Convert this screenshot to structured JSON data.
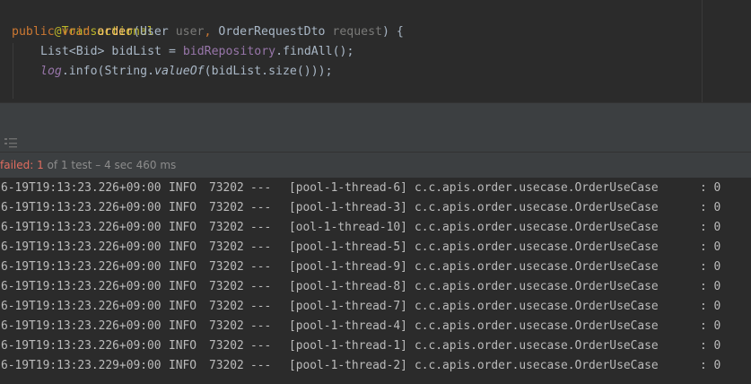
{
  "editor": {
    "line1": {
      "annotation": "@Transactional"
    },
    "line2": {
      "kw_public": "public",
      "kw_void": "void",
      "method": "order",
      "open": "(",
      "type_user": "User",
      "param_user": "user",
      "comma": ",",
      "type_dto": "OrderRequestDto",
      "param_request": "request",
      "close": ") {"
    },
    "line3": {
      "type": "List<Bid>",
      "var": "bidList",
      "eq": "=",
      "field": "bidRepository",
      "call": ".findAll();"
    },
    "line4": {
      "field": "log",
      "call1": ".info(String.",
      "static_method": "valueOf",
      "call2": "(bidList.size()));"
    }
  },
  "status": {
    "failed_label": "failed:",
    "failed_count": "1",
    "summary": "of 1 test – 4 sec 460 ms"
  },
  "colors": {
    "failed": "#e06c5f",
    "annotation": "#bbb529",
    "keyword": "#cc7832",
    "method": "#ffc66d",
    "field": "#9876aa"
  },
  "console": {
    "lines": [
      {
        "ts": "6-19T19:13:23.226+09:00",
        "level": "INFO",
        "pid": "73202",
        "sep": "---",
        "thread": "[pool-1-thread-6]",
        "logger": "c.c.apis.order.usecase.OrderUseCase",
        "msg": ": 0"
      },
      {
        "ts": "6-19T19:13:23.226+09:00",
        "level": "INFO",
        "pid": "73202",
        "sep": "---",
        "thread": "[pool-1-thread-3]",
        "logger": "c.c.apis.order.usecase.OrderUseCase",
        "msg": ": 0"
      },
      {
        "ts": "6-19T19:13:23.226+09:00",
        "level": "INFO",
        "pid": "73202",
        "sep": "---",
        "thread": "[ool-1-thread-10]",
        "logger": "c.c.apis.order.usecase.OrderUseCase",
        "msg": ": 0"
      },
      {
        "ts": "6-19T19:13:23.226+09:00",
        "level": "INFO",
        "pid": "73202",
        "sep": "---",
        "thread": "[pool-1-thread-5]",
        "logger": "c.c.apis.order.usecase.OrderUseCase",
        "msg": ": 0"
      },
      {
        "ts": "6-19T19:13:23.226+09:00",
        "level": "INFO",
        "pid": "73202",
        "sep": "---",
        "thread": "[pool-1-thread-9]",
        "logger": "c.c.apis.order.usecase.OrderUseCase",
        "msg": ": 0"
      },
      {
        "ts": "6-19T19:13:23.226+09:00",
        "level": "INFO",
        "pid": "73202",
        "sep": "---",
        "thread": "[pool-1-thread-8]",
        "logger": "c.c.apis.order.usecase.OrderUseCase",
        "msg": ": 0"
      },
      {
        "ts": "6-19T19:13:23.226+09:00",
        "level": "INFO",
        "pid": "73202",
        "sep": "---",
        "thread": "[pool-1-thread-7]",
        "logger": "c.c.apis.order.usecase.OrderUseCase",
        "msg": ": 0"
      },
      {
        "ts": "6-19T19:13:23.226+09:00",
        "level": "INFO",
        "pid": "73202",
        "sep": "---",
        "thread": "[pool-1-thread-4]",
        "logger": "c.c.apis.order.usecase.OrderUseCase",
        "msg": ": 0"
      },
      {
        "ts": "6-19T19:13:23.226+09:00",
        "level": "INFO",
        "pid": "73202",
        "sep": "---",
        "thread": "[pool-1-thread-1]",
        "logger": "c.c.apis.order.usecase.OrderUseCase",
        "msg": ": 0"
      },
      {
        "ts": "6-19T19:13:23.229+09:00",
        "level": "INFO",
        "pid": "73202",
        "sep": "---",
        "thread": "[pool-1-thread-2]",
        "logger": "c.c.apis.order.usecase.OrderUseCase",
        "msg": ": 0"
      }
    ]
  }
}
